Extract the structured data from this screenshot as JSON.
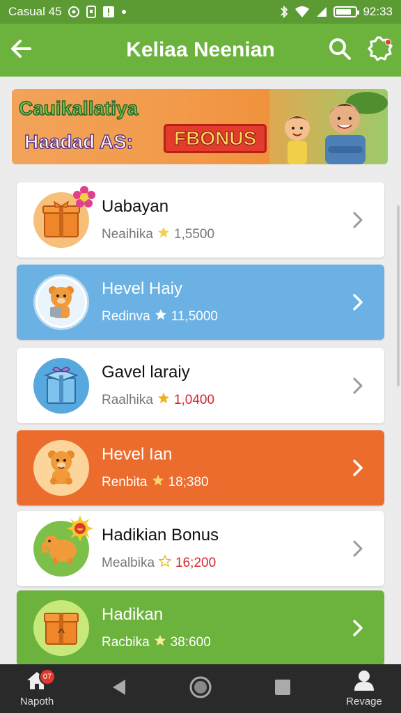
{
  "status_bar": {
    "carrier": "Casual 45",
    "time": "92:33",
    "battery_level": 0.8
  },
  "app_bar": {
    "title": "Keliaa Neenian",
    "back_icon": "arrow-left-icon",
    "search_icon": "search-icon",
    "settings_icon": "gear-icon"
  },
  "banner": {
    "line1": "Cauikallatiya",
    "line2": "Haadad AS:",
    "bonus": "FBONUS"
  },
  "list": [
    {
      "name": "Uabayan",
      "label": "Neaihika",
      "value": "1,5500",
      "style": "white",
      "value_color": "grey",
      "icon": "gift-box-icon",
      "star_color": "#f2d14a"
    },
    {
      "name": "Hevel Haiy",
      "label": "Redinva",
      "value": "11,5000",
      "style": "blue",
      "value_color": "white",
      "icon": "bear-icon",
      "star_color": "#ffffff"
    },
    {
      "name": "Gavel laraiy",
      "label": "Raalhika",
      "value": "1,0400",
      "style": "white",
      "value_color": "red",
      "icon": "gift-box-icon",
      "star_color": "#f0b21e"
    },
    {
      "name": "Hevel Ian",
      "label": "Renbita",
      "value": "18;380",
      "style": "orange",
      "value_color": "white",
      "icon": "bear-icon",
      "star_color": "#f7d56a"
    },
    {
      "name": "Hadikian Bonus",
      "label": "Mealbika",
      "value": "16;200",
      "style": "white",
      "value_color": "red",
      "icon": "bear-icon",
      "star_color": "#f2d14a"
    },
    {
      "name": "Hadikan",
      "label": "Racbika",
      "value": "38:600",
      "style": "green",
      "value_color": "white",
      "icon": "gift-box-icon",
      "star_color": "#f7ee9a"
    }
  ],
  "nav": {
    "home_label": "Napoth",
    "home_badge": "07",
    "profile_label": "Revage"
  },
  "colors": {
    "status_green": "#5c9a33",
    "appbar_green": "#6cb33e",
    "blue": "#6bb1e3",
    "orange": "#ec6c2e",
    "red_value": "#d2282e"
  }
}
